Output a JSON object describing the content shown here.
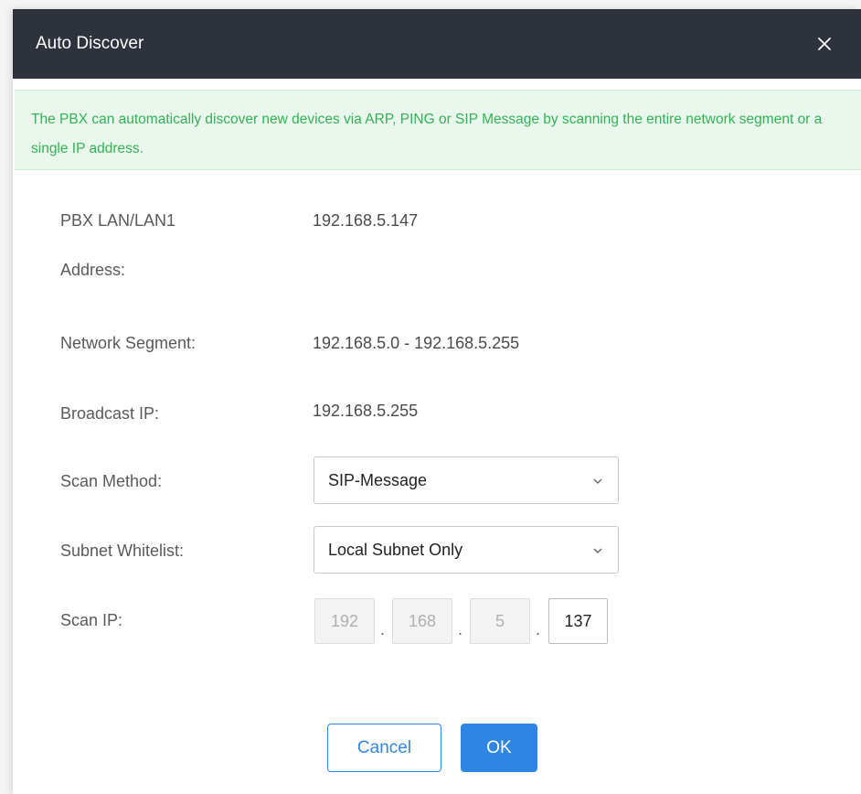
{
  "dialog": {
    "title": "Auto Discover",
    "close_icon": "close-icon"
  },
  "notice": {
    "text": "The PBX can automatically discover new devices via ARP, PING or SIP Message by scanning the entire network segment or a single IP address."
  },
  "fields": {
    "lan_address_label_line1": "PBX LAN/LAN1",
    "lan_address_label_line2": "Address:",
    "lan_address_value": "192.168.5.147",
    "network_segment_label": "Network Segment:",
    "network_segment_value": "192.168.5.0 - 192.168.5.255",
    "broadcast_ip_label": "Broadcast IP:",
    "broadcast_ip_value": "192.168.5.255",
    "scan_method_label": "Scan Method:",
    "scan_method_value": "SIP-Message",
    "subnet_whitelist_label": "Subnet Whitelist:",
    "subnet_whitelist_value": "Local Subnet Only",
    "scan_ip_label": "Scan IP:",
    "scan_ip_octets": [
      "192",
      "168",
      "5",
      "137"
    ],
    "scan_ip_separator": "."
  },
  "buttons": {
    "cancel": "Cancel",
    "ok": "OK"
  },
  "colors": {
    "header_bg": "#2d323d",
    "notice_bg": "#e9f7ec",
    "notice_text": "#34b155",
    "primary": "#2f86e2"
  }
}
